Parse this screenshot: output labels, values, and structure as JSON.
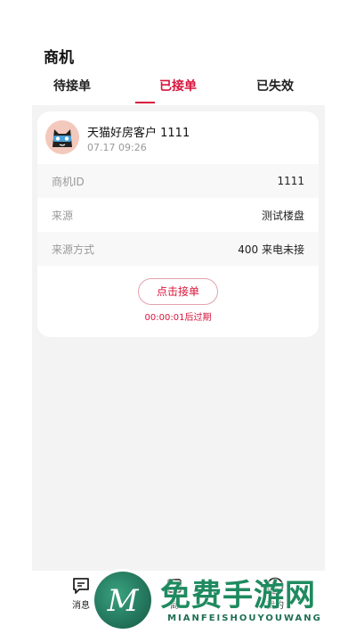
{
  "header": {
    "title": "商机"
  },
  "tabs": [
    {
      "label": "待接单"
    },
    {
      "label": "已接单",
      "active": true
    },
    {
      "label": "已失效"
    }
  ],
  "colors": {
    "accent": "#d8143a",
    "background": "#f3f3f3"
  },
  "card": {
    "avatar_icon": "tmall-cat-avatar-icon",
    "customer_name": "天猫好房客户 1111",
    "time": "07.17 09:26",
    "rows": [
      {
        "key": "商机ID",
        "value": "1111"
      },
      {
        "key": "来源",
        "value": "测试楼盘"
      },
      {
        "key": "来源方式",
        "value": "400 来电未接"
      }
    ],
    "accept_button": "点击接单",
    "expire_text": "00:00:01后过期"
  },
  "tabbar": {
    "items": [
      {
        "label": "消息",
        "icon": "message-icon"
      },
      {
        "label": "商",
        "icon": "business-icon"
      },
      {
        "label": "我的",
        "icon": "profile-icon"
      }
    ]
  },
  "watermark": {
    "logo_letter": "M",
    "text": "免费手游网",
    "subtext": "MIANFEISHOUYOUWANG"
  }
}
